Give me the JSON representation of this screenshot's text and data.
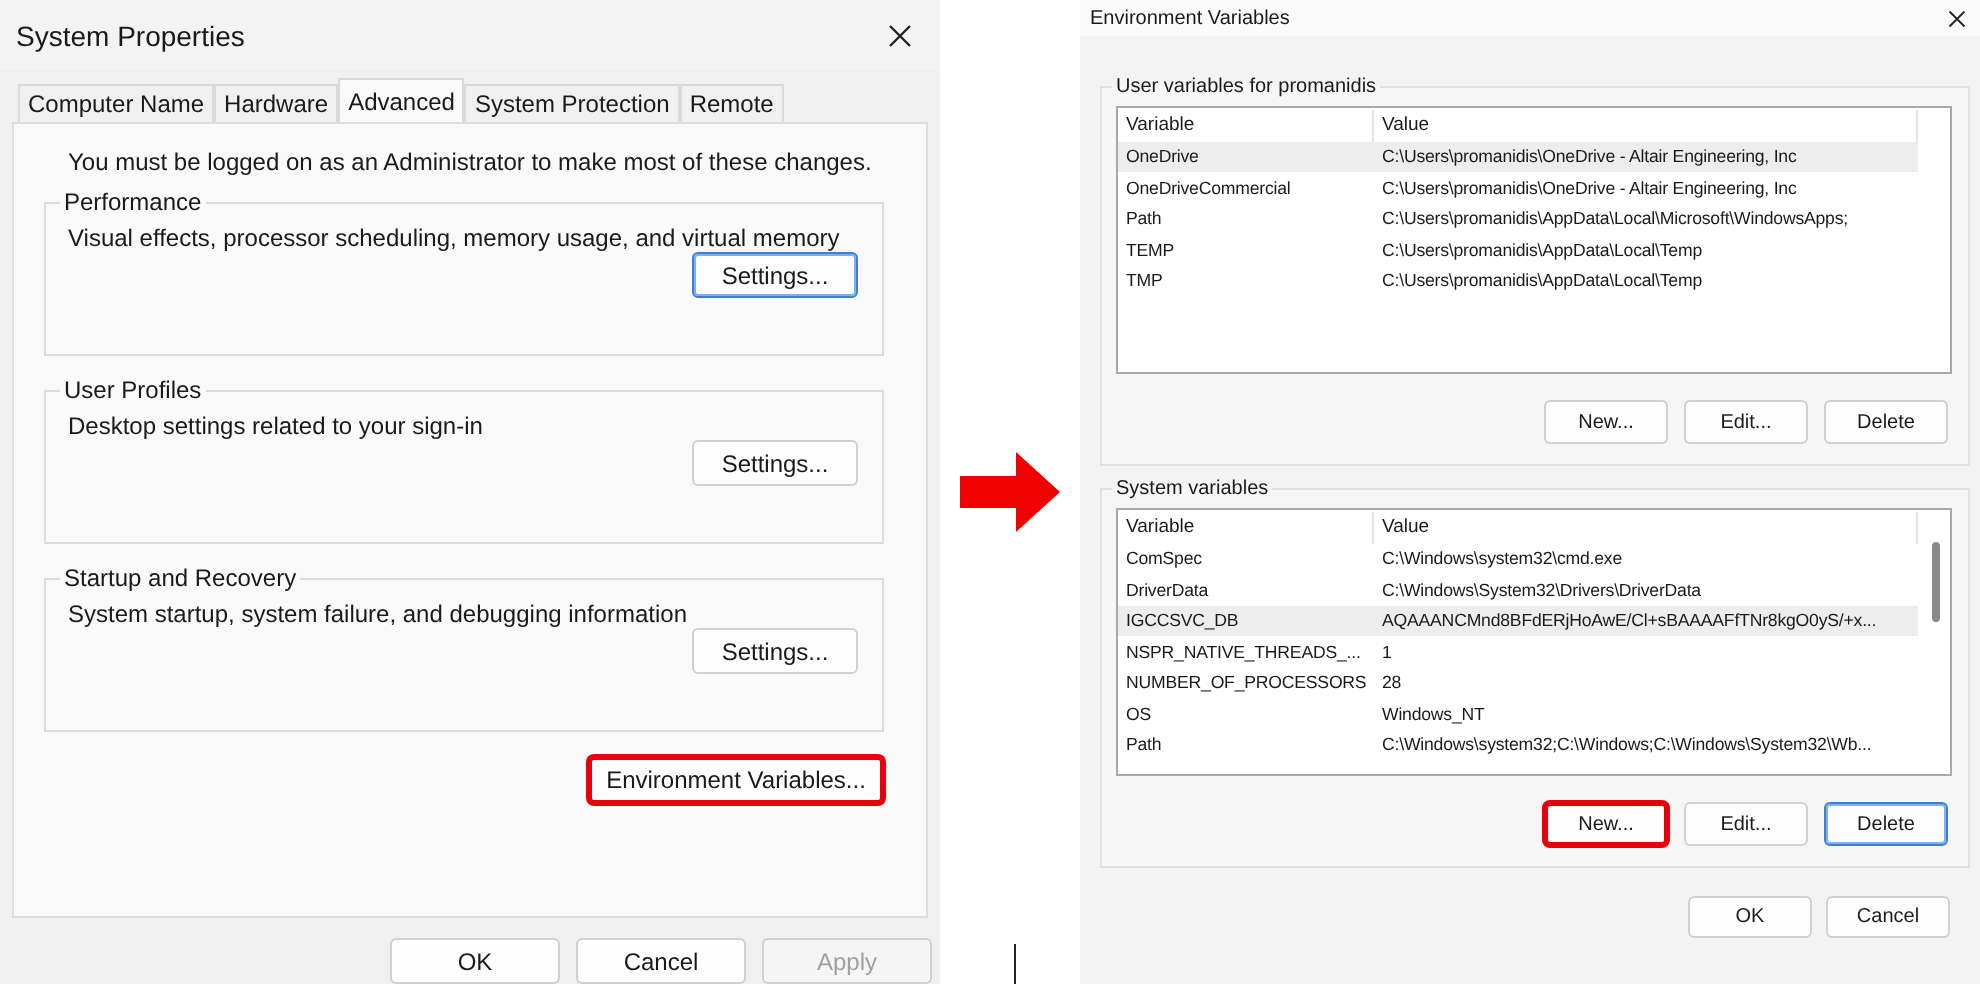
{
  "system_properties": {
    "title": "System Properties",
    "tabs": [
      {
        "label": "Computer Name",
        "selected": false
      },
      {
        "label": "Hardware",
        "selected": false
      },
      {
        "label": "Advanced",
        "selected": true
      },
      {
        "label": "System Protection",
        "selected": false
      },
      {
        "label": "Remote",
        "selected": false
      }
    ],
    "notice": "You must be logged on as an Administrator to make most of these changes.",
    "groups": [
      {
        "title": "Performance",
        "description": "Visual effects, processor scheduling, memory usage, and virtual memory",
        "button": {
          "label": "Settings...",
          "focused": true
        }
      },
      {
        "title": "User Profiles",
        "description": "Desktop settings related to your sign-in",
        "button": {
          "label": "Settings...",
          "focused": false
        }
      },
      {
        "title": "Startup and Recovery",
        "description": "System startup, system failure, and debugging information",
        "button": {
          "label": "Settings...",
          "focused": false
        }
      }
    ],
    "environment_button": {
      "label": "Environment Variables...",
      "highlighted": true
    },
    "buttons": [
      {
        "label": "OK",
        "disabled": false
      },
      {
        "label": "Cancel",
        "disabled": false
      },
      {
        "label": "Apply",
        "disabled": true
      }
    ]
  },
  "environment_variables": {
    "title": "Environment Variables",
    "sections": [
      {
        "title": "User variables for promanidis",
        "columns": [
          "Variable",
          "Value"
        ],
        "rows": [
          {
            "variable": "OneDrive",
            "value": "C:\\Users\\promanidis\\OneDrive - Altair Engineering, Inc",
            "selected": true
          },
          {
            "variable": "OneDriveCommercial",
            "value": "C:\\Users\\promanidis\\OneDrive - Altair Engineering, Inc",
            "selected": false
          },
          {
            "variable": "Path",
            "value": "C:\\Users\\promanidis\\AppData\\Local\\Microsoft\\WindowsApps;",
            "selected": false
          },
          {
            "variable": "TEMP",
            "value": "C:\\Users\\promanidis\\AppData\\Local\\Temp",
            "selected": false
          },
          {
            "variable": "TMP",
            "value": "C:\\Users\\promanidis\\AppData\\Local\\Temp",
            "selected": false
          }
        ],
        "scrollable": false,
        "buttons": [
          {
            "label": "New...",
            "highlighted": false,
            "focused": false
          },
          {
            "label": "Edit...",
            "highlighted": false,
            "focused": false
          },
          {
            "label": "Delete",
            "highlighted": false,
            "focused": false
          }
        ]
      },
      {
        "title": "System variables",
        "columns": [
          "Variable",
          "Value"
        ],
        "rows": [
          {
            "variable": "ComSpec",
            "value": "C:\\Windows\\system32\\cmd.exe",
            "selected": false
          },
          {
            "variable": "DriverData",
            "value": "C:\\Windows\\System32\\Drivers\\DriverData",
            "selected": false
          },
          {
            "variable": "IGCCSVC_DB",
            "value": "AQAAANCMnd8BFdERjHoAwE/Cl+sBAAAAFfTNr8kgO0yS/+x...",
            "selected": true
          },
          {
            "variable": "NSPR_NATIVE_THREADS_...",
            "value": "1",
            "selected": false
          },
          {
            "variable": "NUMBER_OF_PROCESSORS",
            "value": "28",
            "selected": false
          },
          {
            "variable": "OS",
            "value": "Windows_NT",
            "selected": false
          },
          {
            "variable": "Path",
            "value": "C:\\Windows\\system32;C:\\Windows;C:\\Windows\\System32\\Wb...",
            "selected": false
          }
        ],
        "scrollable": true,
        "buttons": [
          {
            "label": "New...",
            "highlighted": true,
            "focused": false
          },
          {
            "label": "Edit...",
            "highlighted": false,
            "focused": false
          },
          {
            "label": "Delete",
            "highlighted": false,
            "focused": true
          }
        ]
      }
    ],
    "buttons": [
      {
        "label": "OK"
      },
      {
        "label": "Cancel"
      }
    ]
  }
}
